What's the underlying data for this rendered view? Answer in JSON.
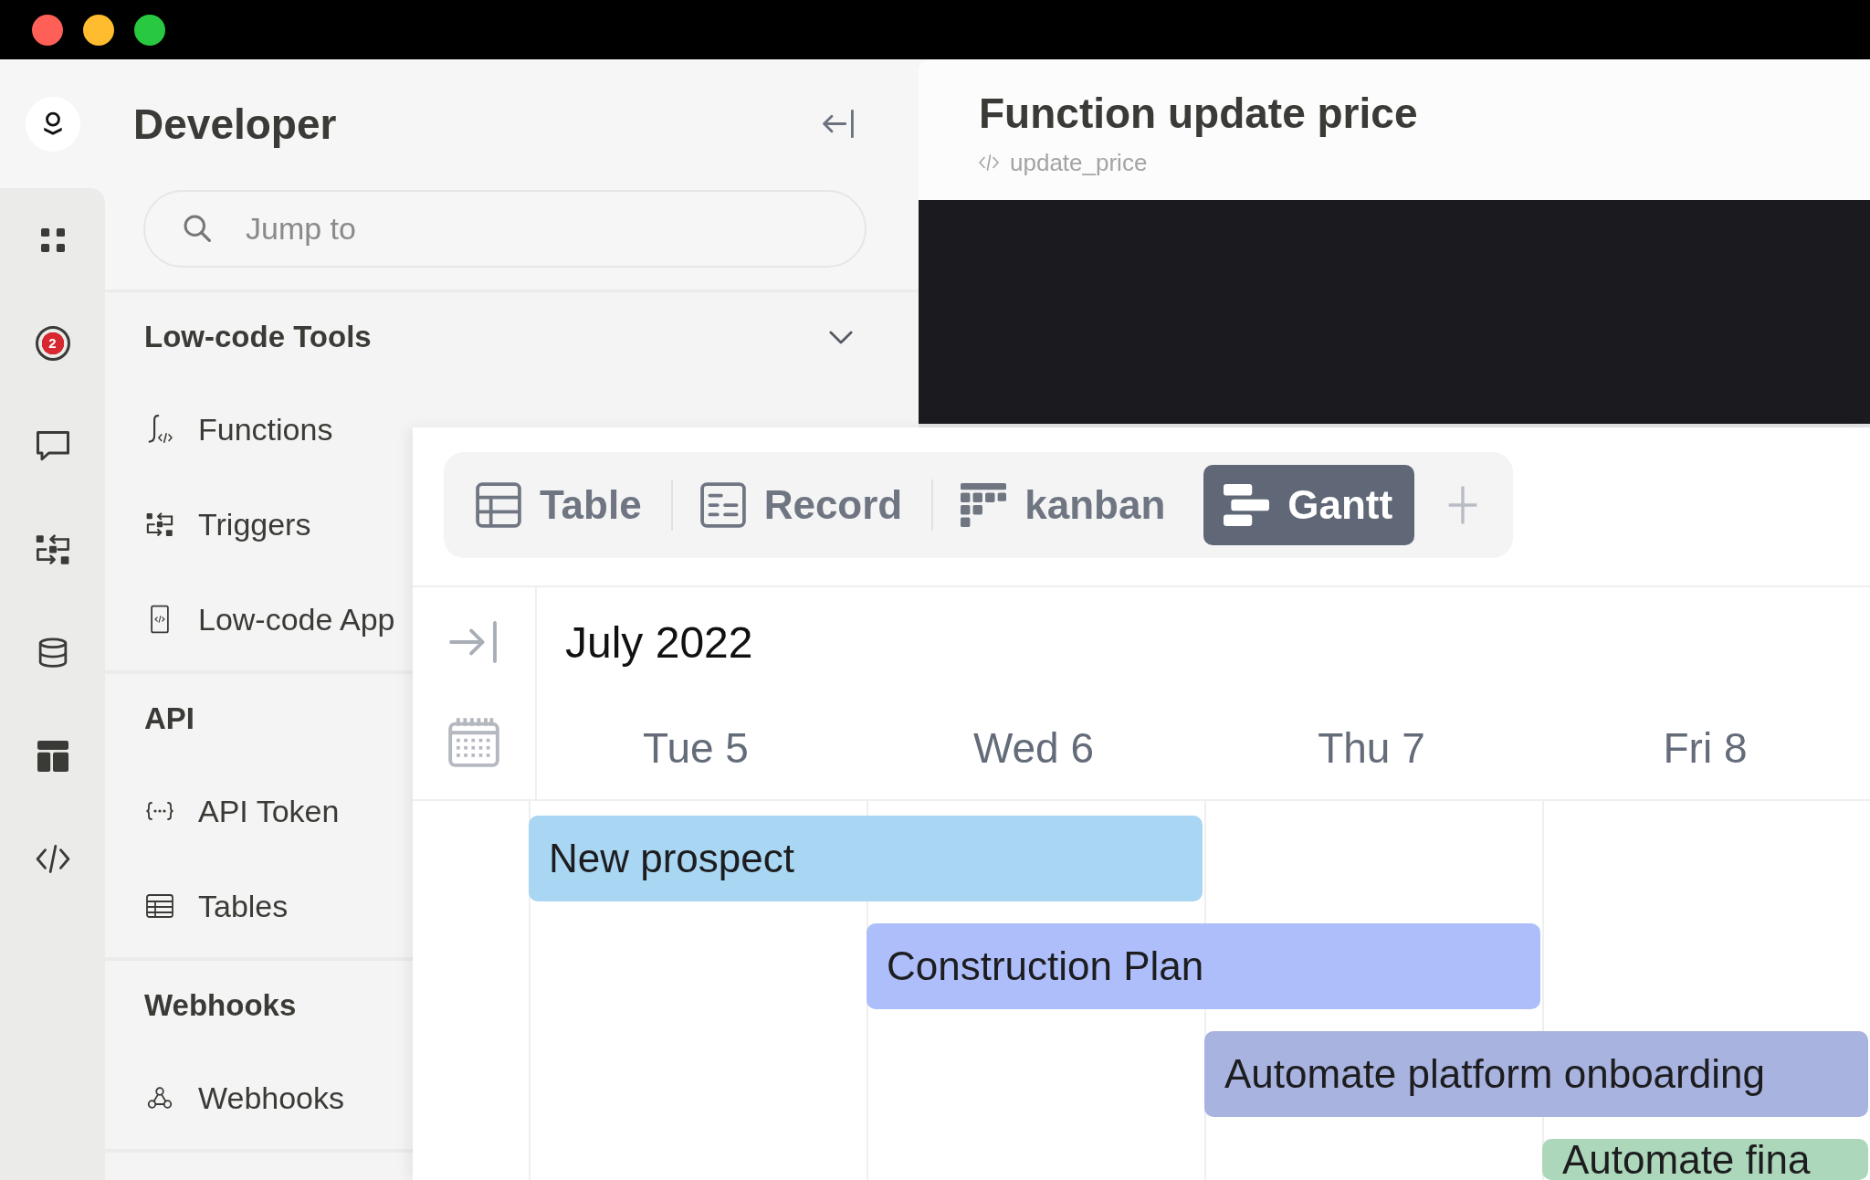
{
  "sidebar_rail": {
    "badge": "2"
  },
  "sidebar": {
    "title": "Developer",
    "search": {
      "placeholder": "Jump to"
    },
    "sections": [
      {
        "title": "Low-code Tools",
        "expanded": true,
        "items": [
          {
            "label": "Functions"
          },
          {
            "label": "Triggers"
          },
          {
            "label": "Low-code App"
          }
        ]
      },
      {
        "title": "API",
        "items": [
          {
            "label": "API Token"
          },
          {
            "label": "Tables"
          }
        ]
      },
      {
        "title": "Webhooks",
        "items": [
          {
            "label": "Webhooks"
          }
        ]
      }
    ]
  },
  "function_panel": {
    "title": "Function update price",
    "identifier": "update_price"
  },
  "view_tabs": [
    {
      "label": "Table",
      "selected": false
    },
    {
      "label": "Record",
      "selected": false
    },
    {
      "label": "kanban",
      "selected": false
    },
    {
      "label": "Gantt",
      "selected": true
    }
  ],
  "gantt": {
    "month": "July 2022",
    "days": [
      "Tue 5",
      "Wed 6",
      "Thu 7",
      "Fri 8"
    ],
    "tasks": [
      {
        "name": "New prospect",
        "color": "#a9d6f3",
        "covers": [
          true,
          true,
          false,
          false
        ]
      },
      {
        "name": "Construction Plan",
        "color": "#aebefa",
        "covers": [
          false,
          true,
          true,
          false
        ]
      },
      {
        "name": "Automate platform onboarding",
        "color": "#a8b3e0",
        "covers": [
          false,
          false,
          true,
          true
        ]
      },
      {
        "name": "Automate fina",
        "color": "#acd7bb",
        "covers": [
          false,
          false,
          false,
          true
        ]
      }
    ]
  }
}
